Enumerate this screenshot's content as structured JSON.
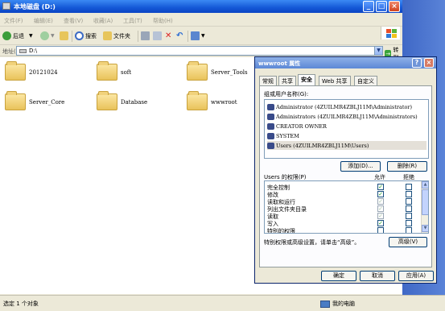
{
  "explorer": {
    "title": "本地磁盘 (D:)",
    "menu": [
      "文件(F)",
      "编辑(E)",
      "查看(V)",
      "收藏(A)",
      "工具(T)",
      "帮助(H)"
    ],
    "toolbar": {
      "back": "后退",
      "search": "搜索",
      "folders": "文件夹"
    },
    "address": {
      "label": "地址(D)",
      "value": "D:\\",
      "go": "转到"
    },
    "folders": [
      "20121024",
      "soft",
      "Server_Tools",
      "Server_Core",
      "Database",
      "wwwroot"
    ],
    "status": {
      "left": "选定 1 个对象",
      "right": "我的电脑"
    }
  },
  "props": {
    "title": "wwwroot 属性",
    "tabs": [
      "常规",
      "共享",
      "安全",
      "Web 共享",
      "自定义"
    ],
    "active_tab": "安全",
    "users_label": "组或用户名称(G):",
    "users": [
      "Administrator (4ZUILMR4ZBLJ11M\\Administrator)",
      "Administrators (4ZUILMR4ZBLJ11M\\Administrators)",
      "CREATOR OWNER",
      "SYSTEM",
      "Users (4ZUILMR4ZBLJ11M\\Users)"
    ],
    "selected_user_index": 4,
    "add_button": "添加(D)...",
    "remove_button": "删除(R)",
    "perm_label": "Users 的权限(P)",
    "allow_col": "允许",
    "deny_col": "拒绝",
    "permissions": [
      {
        "name": "完全控制",
        "allow": true,
        "allow_dim": false
      },
      {
        "name": "修改",
        "allow": true,
        "allow_dim": false
      },
      {
        "name": "读取和运行",
        "allow": true,
        "allow_dim": true
      },
      {
        "name": "列出文件夹目录",
        "allow": true,
        "allow_dim": true
      },
      {
        "name": "读取",
        "allow": true,
        "allow_dim": true
      },
      {
        "name": "写入",
        "allow": true,
        "allow_dim": false
      },
      {
        "name": "特别的权限",
        "allow": false,
        "allow_dim": false
      }
    ],
    "special_text": "特别权限或高级设置，请单击“高级”。",
    "advanced_button": "高级(V)",
    "ok": "确定",
    "cancel": "取消",
    "apply": "应用(A)"
  }
}
